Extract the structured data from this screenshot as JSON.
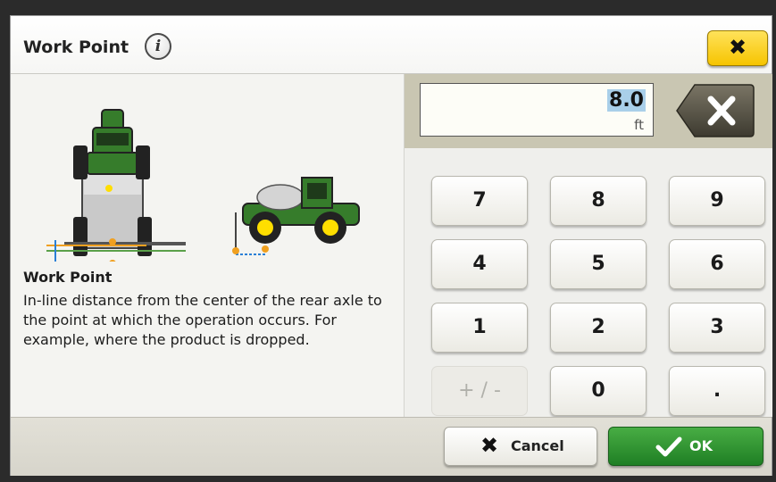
{
  "dialog": {
    "title": "Work Point",
    "info_icon": "info-icon",
    "close_icon": "close-icon",
    "close_glyph": "✖"
  },
  "help": {
    "title": "Work Point",
    "text": "In-line distance from the center of the rear axle to the point at which the operation occurs. For example, where the product is dropped."
  },
  "entry": {
    "value": "8.0",
    "unit": "ft",
    "backspace_icon": "backspace-icon"
  },
  "keypad": {
    "keys": [
      "7",
      "8",
      "9",
      "4",
      "5",
      "6",
      "1",
      "2",
      "3",
      "+ / -",
      "0",
      "."
    ],
    "disabled": [
      "+ / -"
    ]
  },
  "footer": {
    "cancel_label": "Cancel",
    "cancel_glyph": "✖",
    "ok_label": "OK"
  },
  "colors": {
    "close_button": "#f6c400",
    "ok_button": "#2e8b2e",
    "entry_highlight": "#a9cfe9",
    "tractor_green": "#367c2b",
    "tractor_yellow": "#ffde00"
  }
}
